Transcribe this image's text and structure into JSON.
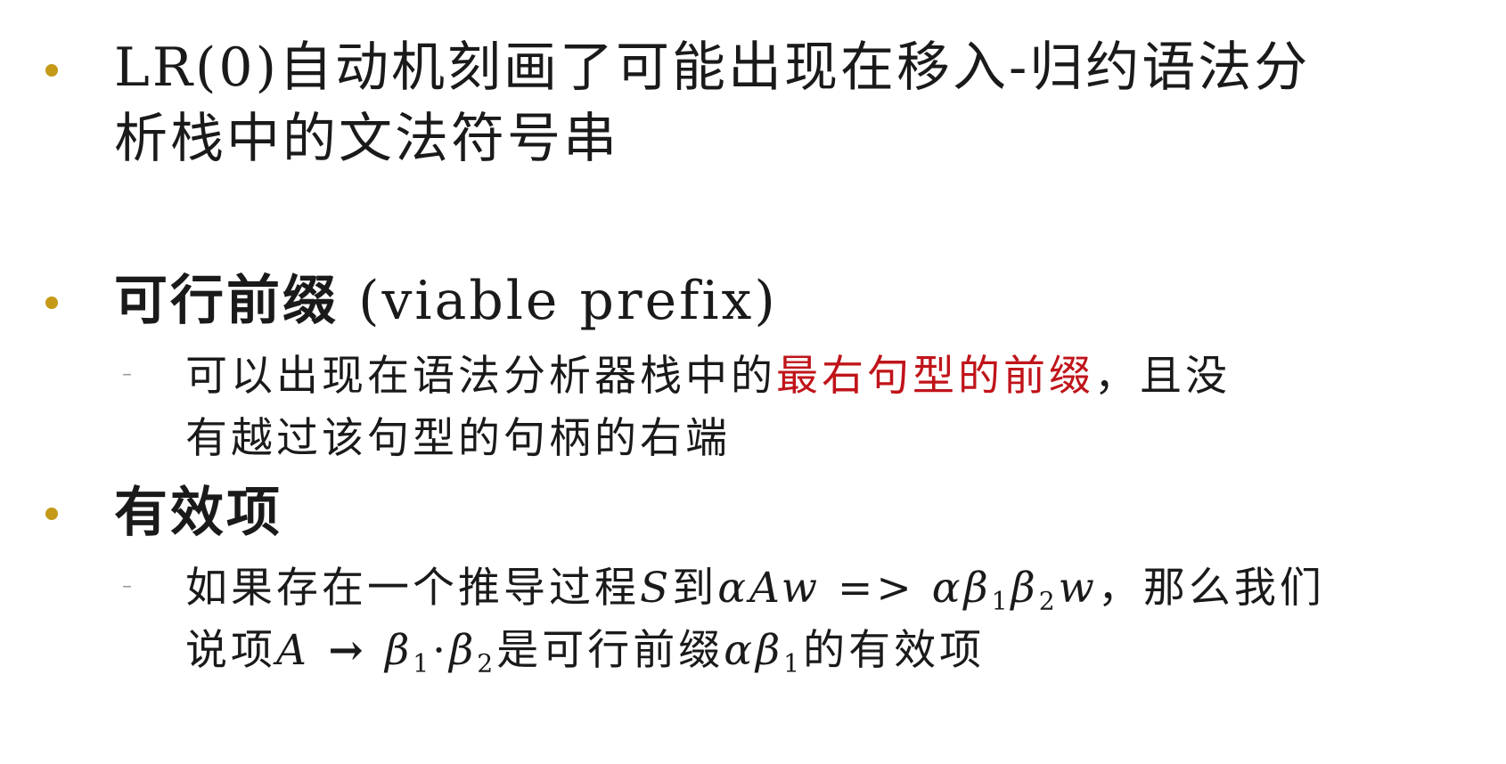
{
  "bullets": [
    {
      "lines": [
        "LR(0)自动机刻画了可能出现在移入-归约语法分",
        "析栈中的文法符号串"
      ]
    },
    {
      "title": "可行前缀",
      "title_suffix": " (viable prefix)",
      "sub": {
        "text_before": "可以出现在语法分析器栈中的",
        "text_red": "最右句型的前缀",
        "text_after": "，且没",
        "line2": "有越过该句型的句柄的右端"
      }
    },
    {
      "title": "有效项",
      "sub": {
        "l1_before": "如果存在一个推导过程",
        "l1_S": "S",
        "l1_to": "到",
        "l1_alpha1": "α",
        "l1_A": "A",
        "l1_w1": "w",
        "l1_arrow": " => ",
        "l1_alpha2": "α",
        "l1_beta1": "β",
        "l1_sub1": "1",
        "l1_beta2": "β",
        "l1_sub2": "2",
        "l1_w2": "w",
        "l1_after": "，那么我们",
        "l2_before": "说项",
        "l2_A": "A",
        "l2_arrow": " → ",
        "l2_beta1": "β",
        "l2_sub1": "1",
        "l2_dot": "·",
        "l2_beta2": "β",
        "l2_sub2": "2",
        "l2_mid": "是可行前缀",
        "l2_alpha": "α",
        "l2_beta3": "β",
        "l2_sub3": "1",
        "l2_after": "的有效项"
      }
    }
  ],
  "colors": {
    "bullet_dot": "#c59a18",
    "highlight": "#c0141a",
    "text": "#1a1a1a"
  }
}
